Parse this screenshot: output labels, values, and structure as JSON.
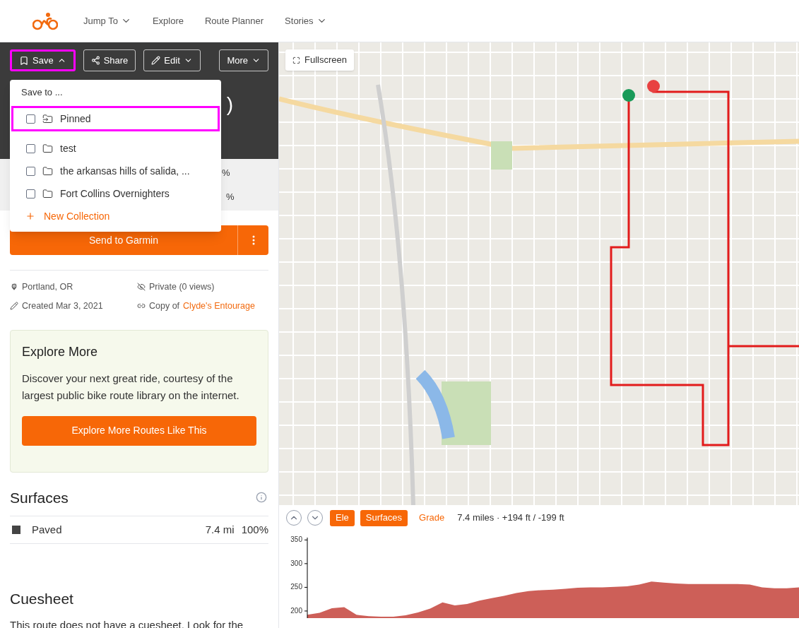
{
  "nav": {
    "items": [
      {
        "label": "Jump To",
        "dropdown": true
      },
      {
        "label": "Explore",
        "dropdown": false
      },
      {
        "label": "Route Planner",
        "dropdown": false
      },
      {
        "label": "Stories",
        "dropdown": true
      }
    ]
  },
  "toolbar": {
    "buttons": [
      {
        "kind": "save",
        "label": "Save",
        "expanded": true,
        "highlighted": true
      },
      {
        "kind": "share",
        "label": "Share",
        "highlighted": false
      },
      {
        "kind": "edit",
        "label": "Edit",
        "expanded": false,
        "highlighted": false
      },
      {
        "kind": "more",
        "label": "More",
        "expanded": false,
        "highlighted": false
      }
    ]
  },
  "route_header": {
    "title_fragment": ")",
    "stats_fragments": [
      "%",
      "%"
    ]
  },
  "save_menu": {
    "heading": "Save to ...",
    "items": [
      {
        "kind": "pinned",
        "label": "Pinned",
        "checked": false,
        "highlighted": true
      },
      {
        "kind": "folder",
        "label": "test",
        "checked": false,
        "highlighted": false
      },
      {
        "kind": "folder",
        "label": "the arkansas hills of salida, ...",
        "checked": false,
        "highlighted": false
      },
      {
        "kind": "folder",
        "label": "Fort Collins Overnighters",
        "checked": false,
        "highlighted": false
      }
    ],
    "new_collection": "New Collection"
  },
  "send_button": "Send to Garmin",
  "meta": {
    "location": "Portland, OR",
    "privacy": "Private (0 views)",
    "created": "Created Mar 3, 2021",
    "copy_prefix": "Copy of",
    "copy_link": "Clyde's Entourage"
  },
  "explore_card": {
    "title": "Explore More",
    "text": "Discover your next great ride, courtesy of the largest public bike route library on the internet.",
    "button": "Explore More Routes Like This"
  },
  "surfaces": {
    "title": "Surfaces",
    "rows": [
      {
        "name": "Paved",
        "color": "#444444",
        "distance": "7.4 mi",
        "percent": "100%"
      }
    ]
  },
  "cuesheet": {
    "title": "Cuesheet",
    "text": "This route does not have a cuesheet. Look for the"
  },
  "map": {
    "fullscreen": "Fullscreen"
  },
  "elevation": {
    "tabs": [
      {
        "label": "Ele",
        "selected": true
      },
      {
        "label": "Surfaces",
        "selected": true
      },
      {
        "label": "Grade",
        "selected": false
      }
    ],
    "summary": "7.4 miles · +194 ft / -199 ft",
    "chart_data": {
      "type": "area",
      "ylim": [
        185,
        355
      ],
      "yticks": [
        200,
        250,
        300,
        350
      ],
      "series": [
        {
          "color": "#cd5f58",
          "values": [
            192,
            196,
            206,
            208,
            192,
            189,
            188,
            188,
            191,
            197,
            205,
            218,
            212,
            215,
            222,
            227,
            232,
            238,
            242,
            244,
            245,
            247,
            249,
            250,
            250,
            251,
            252,
            256,
            262,
            260,
            258,
            257,
            257,
            257,
            257,
            257,
            256,
            250,
            248,
            248,
            250
          ]
        }
      ]
    }
  }
}
